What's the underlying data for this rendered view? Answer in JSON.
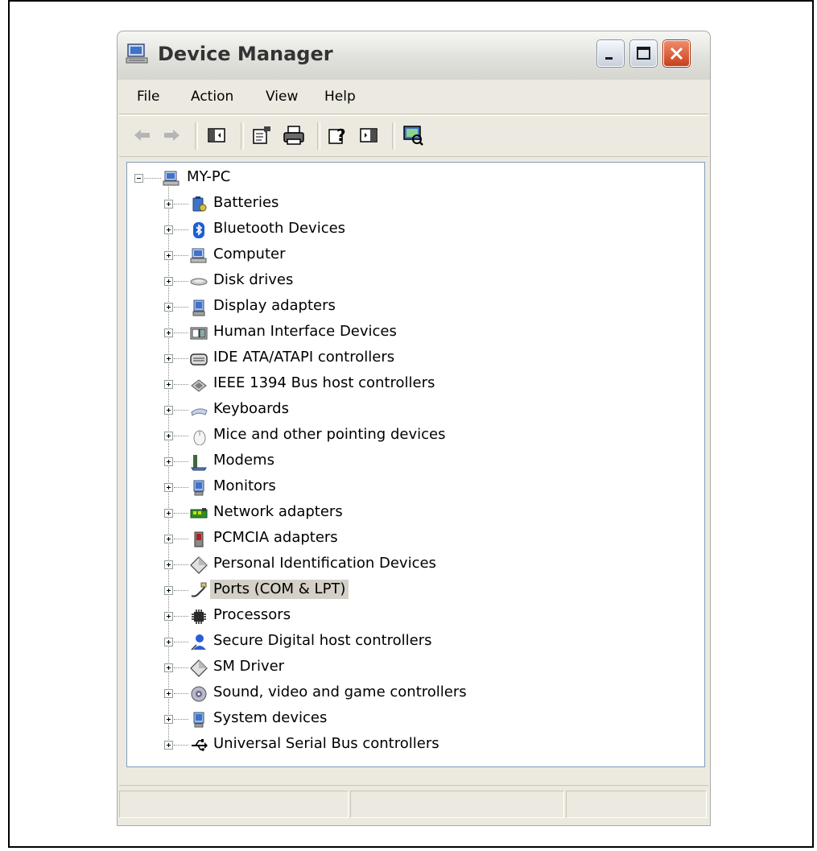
{
  "window": {
    "title": "Device Manager"
  },
  "menu": {
    "items": [
      "File",
      "Action",
      "View",
      "Help"
    ]
  },
  "toolbar": {
    "buttons": [
      {
        "name": "back-icon",
        "enabled": false
      },
      {
        "name": "forward-icon",
        "enabled": false
      },
      {
        "name": "show-hide-console-tree-icon",
        "enabled": true
      },
      {
        "name": "properties-icon",
        "enabled": true
      },
      {
        "name": "print-icon",
        "enabled": true
      },
      {
        "name": "help-icon",
        "enabled": true
      },
      {
        "name": "show-hide-action-pane-icon",
        "enabled": true
      },
      {
        "name": "scan-hardware-icon",
        "enabled": true
      }
    ]
  },
  "tree": {
    "root": {
      "label": "MY-PC",
      "icon": "computer-icon",
      "expanded": true
    },
    "children": [
      {
        "label": "Batteries",
        "icon": "battery-icon"
      },
      {
        "label": "Bluetooth Devices",
        "icon": "bluetooth-icon"
      },
      {
        "label": "Computer",
        "icon": "computer-icon"
      },
      {
        "label": "Disk drives",
        "icon": "disk-drive-icon"
      },
      {
        "label": "Display adapters",
        "icon": "display-adapter-icon"
      },
      {
        "label": "Human Interface Devices",
        "icon": "hid-icon"
      },
      {
        "label": "IDE ATA/ATAPI controllers",
        "icon": "ide-controller-icon"
      },
      {
        "label": "IEEE 1394 Bus host controllers",
        "icon": "ieee1394-icon"
      },
      {
        "label": "Keyboards",
        "icon": "keyboard-icon"
      },
      {
        "label": "Mice and other pointing devices",
        "icon": "mouse-icon"
      },
      {
        "label": "Modems",
        "icon": "modem-icon"
      },
      {
        "label": "Monitors",
        "icon": "monitor-icon"
      },
      {
        "label": "Network adapters",
        "icon": "network-adapter-icon"
      },
      {
        "label": "PCMCIA adapters",
        "icon": "pcmcia-icon"
      },
      {
        "label": "Personal Identification Devices",
        "icon": "diamond-icon"
      },
      {
        "label": "Ports (COM & LPT)",
        "icon": "port-icon",
        "selected": true
      },
      {
        "label": "Processors",
        "icon": "processor-icon"
      },
      {
        "label": "Secure Digital host controllers",
        "icon": "sd-controller-icon"
      },
      {
        "label": "SM Driver",
        "icon": "diamond-icon"
      },
      {
        "label": "Sound, video and game controllers",
        "icon": "sound-icon"
      },
      {
        "label": "System devices",
        "icon": "system-device-icon"
      },
      {
        "label": "Universal Serial Bus controllers",
        "icon": "usb-icon"
      }
    ]
  },
  "colors": {
    "selection": "#d4d0c8",
    "window_bg": "#eceae0",
    "tree_border": "#7f9db9"
  }
}
